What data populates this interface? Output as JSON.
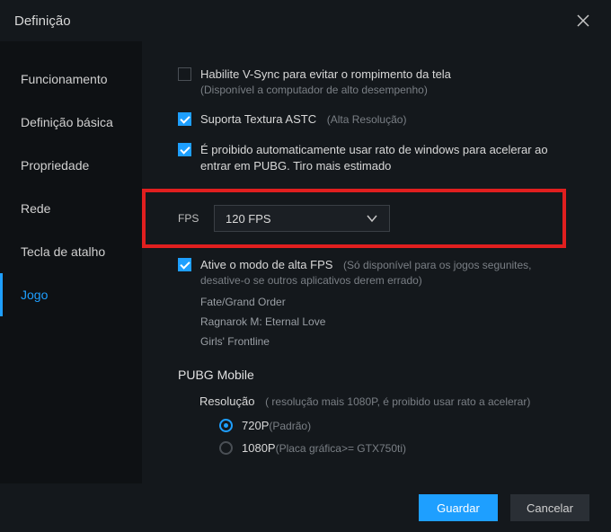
{
  "window": {
    "title": "Definição"
  },
  "sidebar": {
    "items": [
      {
        "label": "Funcionamento",
        "active": false
      },
      {
        "label": "Definição básica",
        "active": false
      },
      {
        "label": "Propriedade",
        "active": false
      },
      {
        "label": "Rede",
        "active": false
      },
      {
        "label": "Tecla de atalho",
        "active": false
      },
      {
        "label": "Jogo",
        "active": true
      }
    ]
  },
  "settings": {
    "vsync": {
      "label": "Habilite V-Sync para evitar o rompimento da tela",
      "sub": "(Disponível a computador de alto desempenho)",
      "checked": false
    },
    "astc": {
      "label": "Suporta Textura ASTC",
      "sub": "(Alta Resolução)",
      "checked": true
    },
    "pubg_mouse": {
      "label": "É proibido automaticamente usar rato de windows para acelerar ao entrar em PUBG. Tiro mais estimado",
      "checked": true
    },
    "fps": {
      "label": "FPS",
      "value": "120 FPS"
    },
    "high_fps": {
      "label": "Ative o modo de alta FPS",
      "sub": "(Só disponível para os jogos segunites, desative-o se outros aplicativos derem errado)",
      "checked": true,
      "games": [
        "Fate/Grand Order",
        "Ragnarok M: Eternal Love",
        "Girls' Frontline"
      ]
    },
    "pubg_mobile": {
      "title": "PUBG Mobile",
      "resolution": {
        "label": "Resolução",
        "hint": "( resolução mais 1080P, é proibido usar rato a acelerar)",
        "options": [
          {
            "value": "720P",
            "sub": "(Padrão)",
            "selected": true
          },
          {
            "value": "1080P",
            "sub": "(Placa gráfica>= GTX750ti)",
            "selected": false
          }
        ]
      }
    }
  },
  "footer": {
    "save": "Guardar",
    "cancel": "Cancelar"
  }
}
